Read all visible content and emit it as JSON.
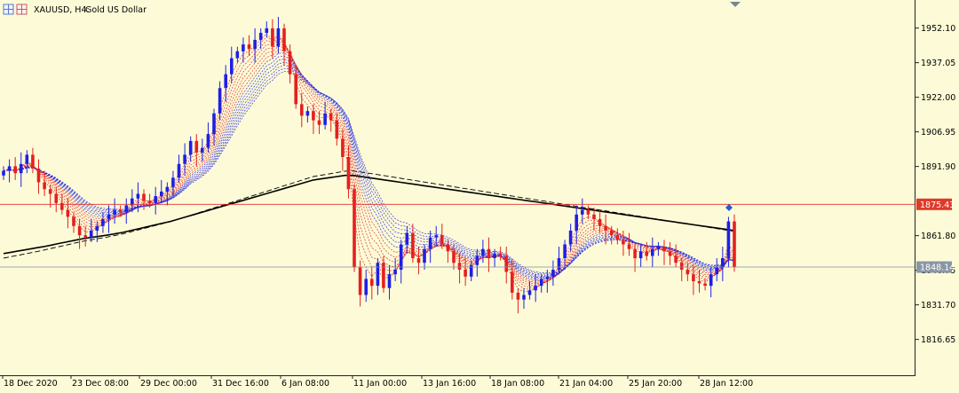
{
  "header": {
    "symbol": "XAUUSD, H4:",
    "description": "Gold US Dollar"
  },
  "colors": {
    "background": "#fdfbd7",
    "bull_candle": "#1f1fe6",
    "bear_candle": "#e61f1f",
    "moving_average": "#000000",
    "fan_fast": "#e02020",
    "fan_slow": "#2020e0",
    "price_line": "#e03030",
    "bid_line": "#7f8fa0"
  },
  "chart_data": {
    "type": "candlestick",
    "timeframe": "H4",
    "title": "XAUUSD, H4:  Gold US Dollar",
    "ylim": [
      1803,
      1962
    ],
    "y_ticks": [
      1952.1,
      1937.05,
      1922.0,
      1906.95,
      1891.9,
      1861.8,
      1846.75,
      1831.7,
      1816.65
    ],
    "x_ticks": [
      "18 Dec 2020",
      "23 Dec 08:00",
      "29 Dec 00:00",
      "31 Dec 16:00",
      "6 Jan 08:00",
      "11 Jan 00:00",
      "13 Jan 16:00",
      "18 Jan 08:00",
      "21 Jan 04:00",
      "25 Jan 20:00",
      "28 Jan 12:00"
    ],
    "price_markers": [
      {
        "label": "1875.43",
        "value": 1875.43,
        "style": "red"
      },
      {
        "label": "1848.14",
        "value": 1848.14,
        "style": "gray"
      }
    ],
    "close": [
      1890,
      1892,
      1889,
      1893,
      1897,
      1891,
      1885,
      1882,
      1880,
      1876,
      1873,
      1870,
      1866,
      1862,
      1861,
      1864,
      1866,
      1869,
      1871,
      1873,
      1872,
      1875,
      1878,
      1880,
      1877,
      1876,
      1879,
      1881,
      1883,
      1887,
      1893,
      1897,
      1903,
      1898,
      1900,
      1906,
      1915,
      1926,
      1932,
      1939,
      1942,
      1945,
      1943,
      1947,
      1950,
      1952,
      1944,
      1952,
      1942,
      1932,
      1919,
      1914,
      1916,
      1912,
      1910,
      1915,
      1912,
      1904,
      1896,
      1882,
      1848,
      1836,
      1843,
      1840,
      1850,
      1839,
      1845,
      1847,
      1858,
      1863,
      1852,
      1850,
      1856,
      1861,
      1862,
      1858,
      1855,
      1850,
      1847,
      1844,
      1849,
      1853,
      1856,
      1852,
      1854,
      1853,
      1846,
      1837,
      1834,
      1836,
      1838,
      1840,
      1843,
      1844,
      1847,
      1852,
      1858,
      1864,
      1871,
      1873,
      1871,
      1869,
      1866,
      1864,
      1862,
      1860,
      1858,
      1856,
      1852,
      1855,
      1853,
      1856,
      1857,
      1855,
      1853,
      1850,
      1847,
      1845,
      1842,
      1841,
      1840,
      1845,
      1848,
      1852,
      1868,
      1848.14
    ],
    "sma": [
      1854,
      1854.6,
      1855.2,
      1855.8,
      1856.4,
      1857,
      1857.7,
      1858.4,
      1859.1,
      1859.8,
      1860.5,
      1861,
      1861.5,
      1862,
      1862.6,
      1863.2,
      1864,
      1864.8,
      1865.6,
      1866.4,
      1867.2,
      1868,
      1869,
      1870,
      1871,
      1872,
      1873,
      1874,
      1875,
      1876,
      1877,
      1878,
      1879,
      1880,
      1881,
      1882,
      1883,
      1884,
      1885,
      1886,
      1886.5,
      1887,
      1887.5,
      1888,
      1888,
      1887.5,
      1887,
      1886.5,
      1886,
      1885.5,
      1885,
      1884.5,
      1884,
      1883.5,
      1883,
      1882.5,
      1882,
      1881.5,
      1881,
      1880.5,
      1880,
      1879.5,
      1879,
      1878.5,
      1878,
      1877.5,
      1877,
      1876.5,
      1876,
      1875.5,
      1875,
      1874.5,
      1874,
      1873.5,
      1873,
      1872.5,
      1872,
      1871.5,
      1871,
      1870.5,
      1870,
      1869.5,
      1869,
      1868.5,
      1868,
      1867.5,
      1867,
      1866.5,
      1866,
      1865.5,
      1865,
      1864.5,
      1864
    ]
  }
}
